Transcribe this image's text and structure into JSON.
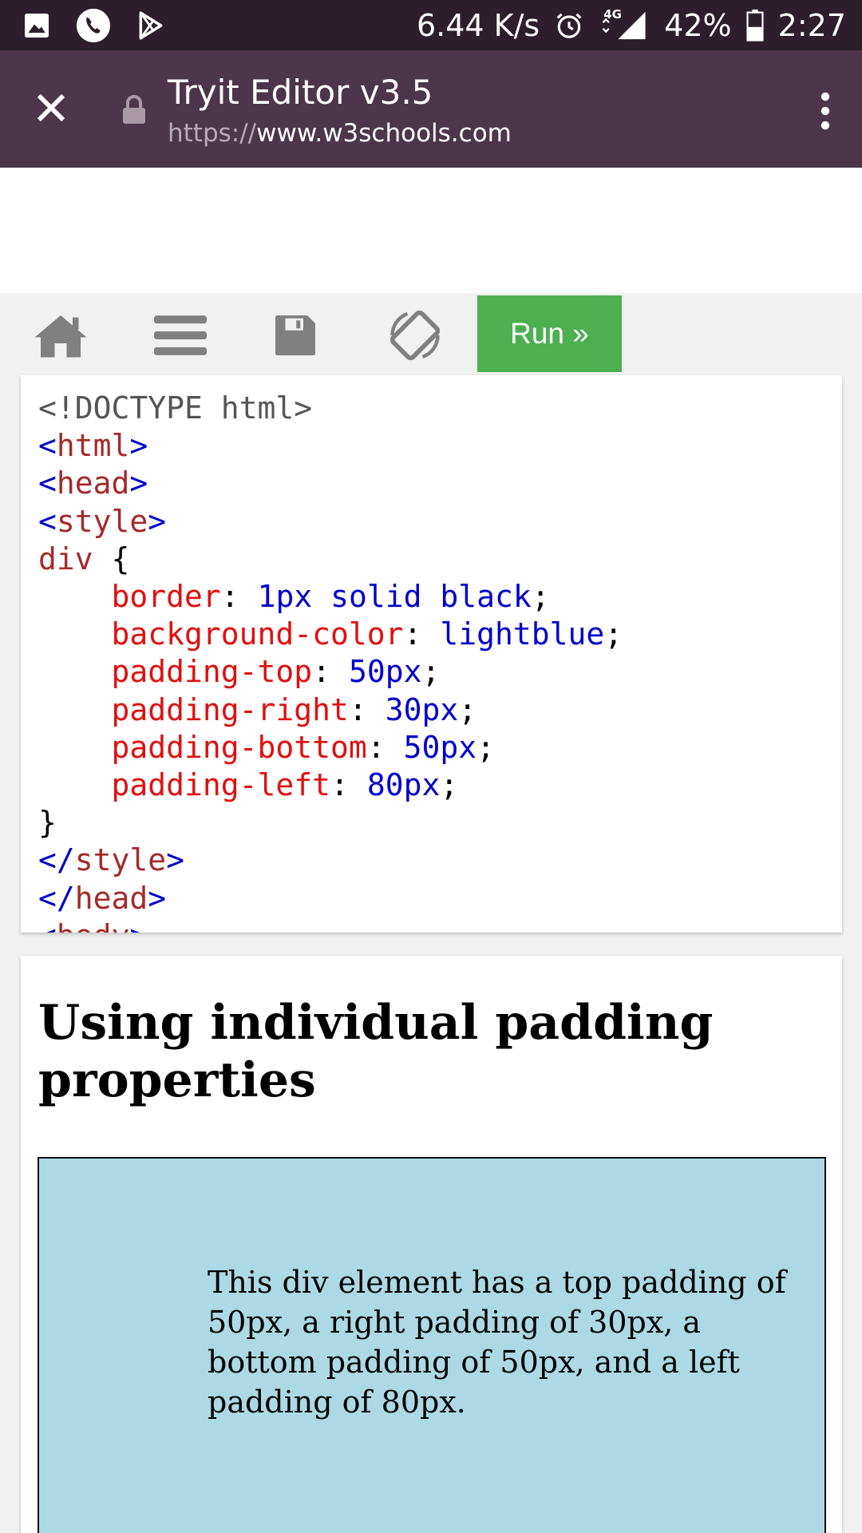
{
  "status_bar": {
    "speed": "6.44 K/s",
    "network": "4G",
    "battery": "42%",
    "time": "2:27"
  },
  "toolbar": {
    "title": "Tryit Editor v3.5",
    "url_scheme": "https://",
    "url_host": "www.w3schools.com"
  },
  "editor": {
    "run_label": "Run »"
  },
  "code_lines": [
    [
      {
        "t": "<!DOCTYPE html>",
        "c": "c-plain"
      }
    ],
    [
      {
        "t": "<",
        "c": "c-br"
      },
      {
        "t": "html",
        "c": "c-tag"
      },
      {
        "t": ">",
        "c": "c-br"
      }
    ],
    [
      {
        "t": "<",
        "c": "c-br"
      },
      {
        "t": "head",
        "c": "c-tag"
      },
      {
        "t": ">",
        "c": "c-br"
      }
    ],
    [
      {
        "t": "<",
        "c": "c-br"
      },
      {
        "t": "style",
        "c": "c-tag"
      },
      {
        "t": ">",
        "c": "c-br"
      }
    ],
    [
      {
        "t": "div",
        "c": "c-tag"
      },
      {
        "t": " {",
        "c": "c-txt"
      }
    ],
    [
      {
        "t": "    ",
        "c": "c-txt"
      },
      {
        "t": "border",
        "c": "c-prop"
      },
      {
        "t": ": ",
        "c": "c-txt"
      },
      {
        "t": "1px solid black",
        "c": "c-val"
      },
      {
        "t": ";",
        "c": "c-txt"
      }
    ],
    [
      {
        "t": "    ",
        "c": "c-txt"
      },
      {
        "t": "background-color",
        "c": "c-prop"
      },
      {
        "t": ": ",
        "c": "c-txt"
      },
      {
        "t": "lightblue",
        "c": "c-val"
      },
      {
        "t": ";",
        "c": "c-txt"
      }
    ],
    [
      {
        "t": "    ",
        "c": "c-txt"
      },
      {
        "t": "padding-top",
        "c": "c-prop"
      },
      {
        "t": ": ",
        "c": "c-txt"
      },
      {
        "t": "50px",
        "c": "c-val"
      },
      {
        "t": ";",
        "c": "c-txt"
      }
    ],
    [
      {
        "t": "    ",
        "c": "c-txt"
      },
      {
        "t": "padding-right",
        "c": "c-prop"
      },
      {
        "t": ": ",
        "c": "c-txt"
      },
      {
        "t": "30px",
        "c": "c-val"
      },
      {
        "t": ";",
        "c": "c-txt"
      }
    ],
    [
      {
        "t": "    ",
        "c": "c-txt"
      },
      {
        "t": "padding-bottom",
        "c": "c-prop"
      },
      {
        "t": ": ",
        "c": "c-txt"
      },
      {
        "t": "50px",
        "c": "c-val"
      },
      {
        "t": ";",
        "c": "c-txt"
      }
    ],
    [
      {
        "t": "    ",
        "c": "c-txt"
      },
      {
        "t": "padding-left",
        "c": "c-prop"
      },
      {
        "t": ": ",
        "c": "c-txt"
      },
      {
        "t": "80px",
        "c": "c-val"
      },
      {
        "t": ";",
        "c": "c-txt"
      }
    ],
    [
      {
        "t": "}",
        "c": "c-txt"
      }
    ],
    [
      {
        "t": "</",
        "c": "c-br"
      },
      {
        "t": "style",
        "c": "c-tag"
      },
      {
        "t": ">",
        "c": "c-br"
      }
    ],
    [
      {
        "t": "</",
        "c": "c-br"
      },
      {
        "t": "head",
        "c": "c-tag"
      },
      {
        "t": ">",
        "c": "c-br"
      }
    ],
    [
      {
        "t": "<",
        "c": "c-br"
      },
      {
        "t": "body",
        "c": "c-tag"
      },
      {
        "t": ">",
        "c": "c-br"
      }
    ]
  ],
  "result": {
    "heading": "Using individual padding properties",
    "paragraph": "This div element has a top padding of 50px, a right padding of 30px, a bottom padding of 50px, and a left padding of 80px."
  }
}
